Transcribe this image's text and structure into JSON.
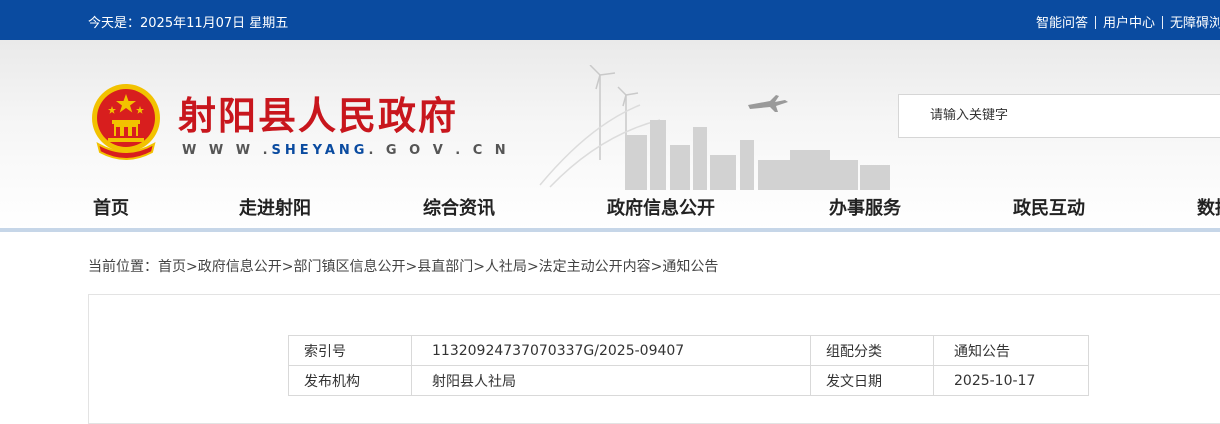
{
  "topbar": {
    "date": "今天是：2025年11月07日 星期五",
    "links": [
      "智能问答",
      "用户中心",
      "无障碍浏"
    ]
  },
  "header": {
    "title": "射阳县人民政府",
    "url_prefix": "W W W .",
    "url_main": "SHEYANG",
    "url_suffix": ". G O V . C N",
    "search_placeholder": "请输入关键字"
  },
  "nav": [
    "首页",
    "走进射阳",
    "综合资讯",
    "政府信息公开",
    "办事服务",
    "政民互动",
    "数据"
  ],
  "breadcrumb": {
    "prefix": "当前位置：",
    "items": [
      "首页",
      "政府信息公开",
      "部门镇区信息公开",
      "县直部门",
      "人社局",
      "法定主动公开内容",
      "通知公告"
    ]
  },
  "meta_table": {
    "rows": [
      {
        "k1": "索引号",
        "v1": "11320924737070337G/2025-09407",
        "k2": "组配分类",
        "v2": "通知公告"
      },
      {
        "k1": "发布机构",
        "v1": "射阳县人社局",
        "k2": "发文日期",
        "v2": "2025-10-17"
      }
    ]
  },
  "colors": {
    "brand_blue": "#0a4ba0",
    "title_red": "#c8161d",
    "nav_line": "#c6d6e8"
  },
  "icons": [
    "national-emblem-icon",
    "city-skyline-icon"
  ]
}
